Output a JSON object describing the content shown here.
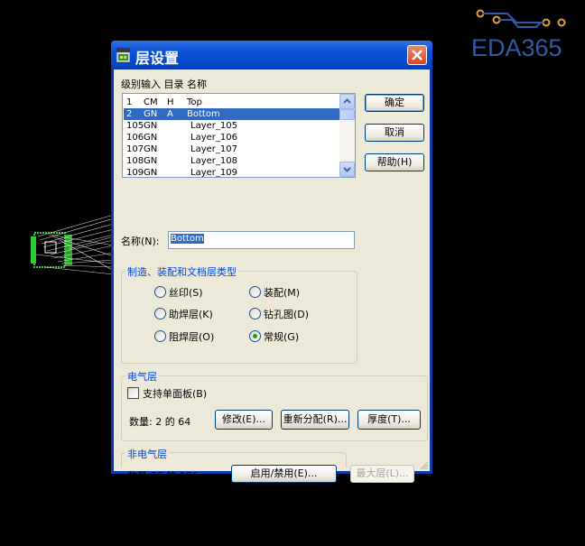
{
  "watermark": {
    "brand": "EDA365"
  },
  "dialog": {
    "title": "层设置",
    "buttons": {
      "ok": "确定",
      "cancel": "取消",
      "help": "帮助(H)"
    },
    "list": {
      "header": "级别输入 目录 名称",
      "rows": [
        {
          "level": "1",
          "dir": "CM",
          "flag": "H",
          "name": "Top",
          "selected": false
        },
        {
          "level": "2",
          "dir": "GN",
          "flag": "A",
          "name": "Bottom",
          "selected": true
        },
        {
          "level": "105",
          "dir": "GN",
          "flag": "",
          "name": "Layer_105",
          "selected": false
        },
        {
          "level": "106",
          "dir": "GN",
          "flag": "",
          "name": "Layer_106",
          "selected": false
        },
        {
          "level": "107",
          "dir": "GN",
          "flag": "",
          "name": "Layer_107",
          "selected": false
        },
        {
          "level": "108",
          "dir": "GN",
          "flag": "",
          "name": "Layer_108",
          "selected": false
        },
        {
          "level": "109",
          "dir": "GN",
          "flag": "",
          "name": "Layer_109",
          "selected": false
        }
      ]
    },
    "name_field": {
      "label": "名称(N):",
      "value": "Bottom"
    },
    "doc_group": {
      "title": "制造、装配和文档层类型",
      "options": [
        {
          "label": "丝印(S)",
          "checked": false
        },
        {
          "label": "装配(M)",
          "checked": false
        },
        {
          "label": "助焊层(K)",
          "checked": false
        },
        {
          "label": "钻孔图(D)",
          "checked": false
        },
        {
          "label": "阻焊层(O)",
          "checked": false
        },
        {
          "label": "常规(G)",
          "checked": true
        }
      ]
    },
    "elec_group": {
      "title": "电气层",
      "single_sided_label": "支持单面板(B)",
      "single_sided_checked": false,
      "count_text": "数量: 2 的 64",
      "modify_button": "修改(E)...",
      "reassign_button": "重新分配(R)...",
      "thickness_button": "厚度(T)..."
    },
    "nonelec_group": {
      "title": "非电气层",
      "count_text": "数量:26 的 186",
      "enable_button": "启用/禁用(E)...",
      "max_layer_button": "最大层(L)..."
    }
  },
  "colors": {
    "title_bar": "#0a50d8",
    "selection": "#316ac5",
    "group_title": "#0046d5",
    "brand": "#2f5aa4"
  }
}
